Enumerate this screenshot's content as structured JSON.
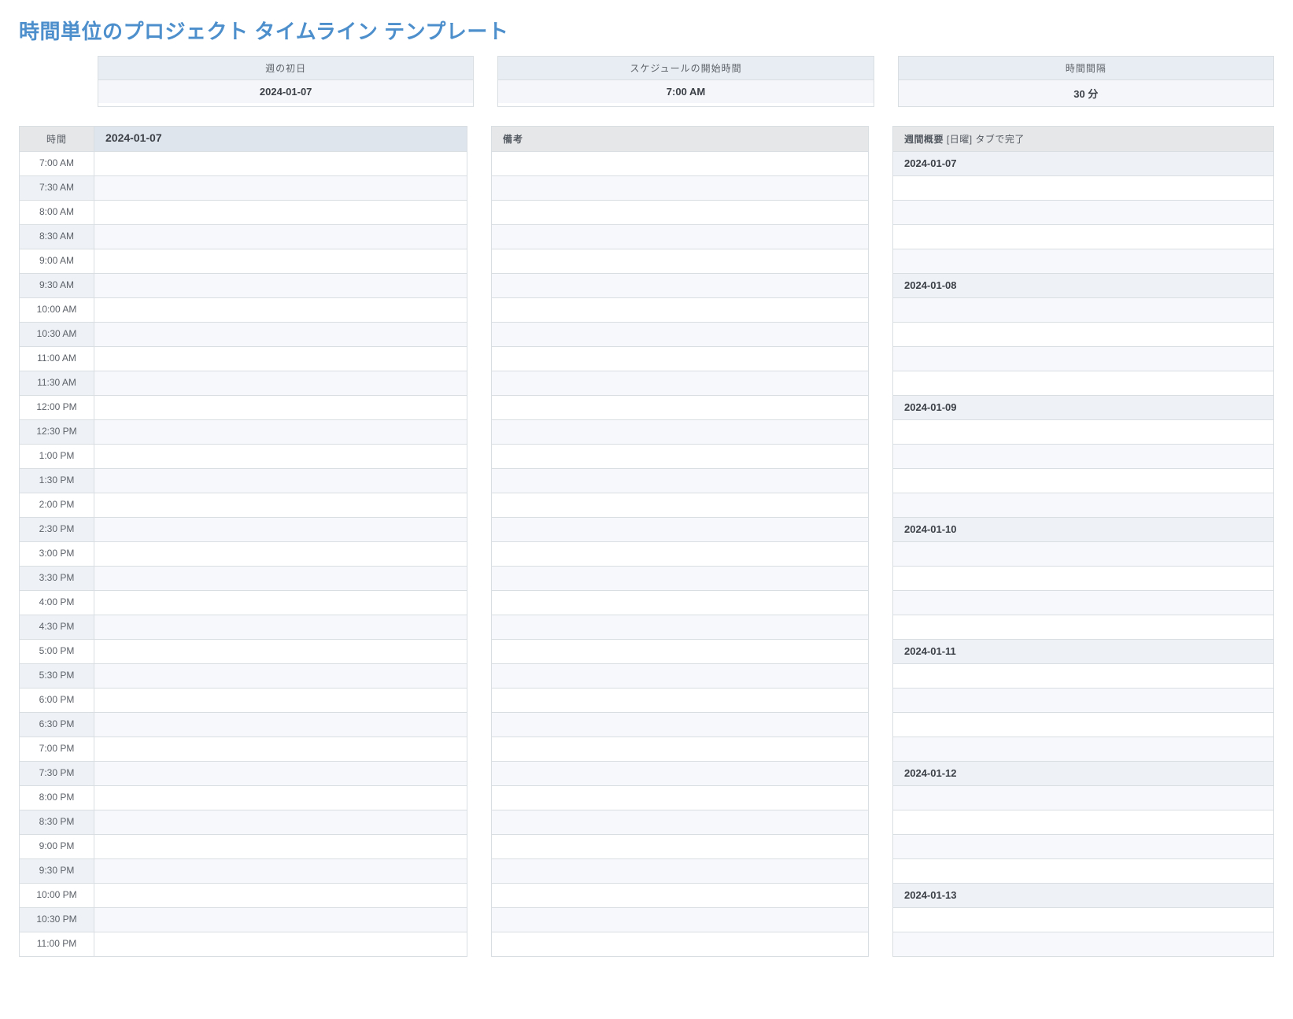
{
  "title": "時間単位のプロジェクト タイムライン テンプレート",
  "config": {
    "first_day_label": "週の初日",
    "first_day_value": "2024-01-07",
    "start_time_label": "スケジュールの開始時間",
    "start_time_value": "7:00 AM",
    "interval_label": "時間間隔",
    "interval_value": "30 分"
  },
  "time_column": {
    "time_header": "時間",
    "date_header": "2024-01-07",
    "rows": [
      "7:00 AM",
      "7:30 AM",
      "8:00 AM",
      "8:30 AM",
      "9:00 AM",
      "9:30 AM",
      "10:00 AM",
      "10:30 AM",
      "11:00 AM",
      "11:30 AM",
      "12:00 PM",
      "12:30 PM",
      "1:00 PM",
      "1:30 PM",
      "2:00 PM",
      "2:30 PM",
      "3:00 PM",
      "3:30 PM",
      "4:00 PM",
      "4:30 PM",
      "5:00 PM",
      "5:30 PM",
      "6:00 PM",
      "6:30 PM",
      "7:00 PM",
      "7:30 PM",
      "8:00 PM",
      "8:30 PM",
      "9:00 PM",
      "9:30 PM",
      "10:00 PM",
      "10:30 PM",
      "11:00 PM"
    ]
  },
  "notes_column": {
    "header": "備考",
    "row_count": 33
  },
  "week_column": {
    "header_bold": "週間概要",
    "header_note": "[日曜] タブで完了",
    "days": [
      "2024-01-07",
      "2024-01-08",
      "2024-01-09",
      "2024-01-10",
      "2024-01-11",
      "2024-01-12",
      "2024-01-13"
    ],
    "blank_per_day": 4,
    "blank_last_day": 2
  }
}
